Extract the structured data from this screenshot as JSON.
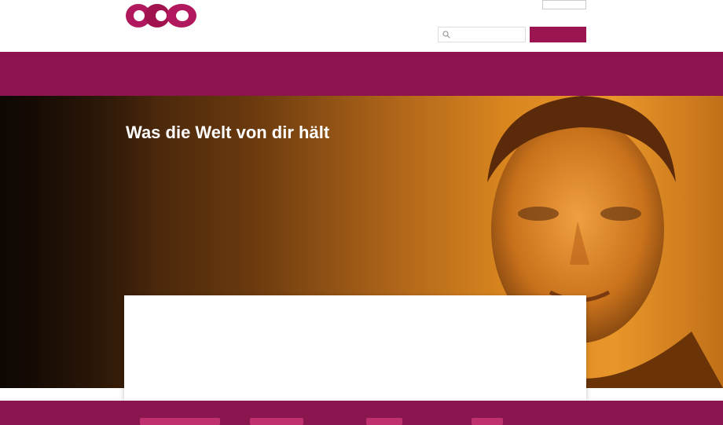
{
  "header": {
    "logo_text": "",
    "top_links": [
      "",
      "",
      "",
      ""
    ],
    "language": "",
    "search": {
      "placeholder": "",
      "button_label": ""
    }
  },
  "nav": {
    "items": [
      "",
      "",
      "",
      "",
      ""
    ]
  },
  "hero": {
    "title": "Was die Welt von dir hält",
    "text": "",
    "subhead": "",
    "subtext": "",
    "link": ""
  },
  "cards": [
    {
      "title": "",
      "text": "",
      "link": ""
    },
    {
      "title": "",
      "text": "",
      "link": ""
    }
  ],
  "colors": {
    "brand": "#8e1450",
    "brand_accent": "#c2307a",
    "hero_orange": "#e8962a",
    "link_gold": "#e39a28"
  },
  "icons": [
    "logo-rings",
    "search-icon"
  ]
}
